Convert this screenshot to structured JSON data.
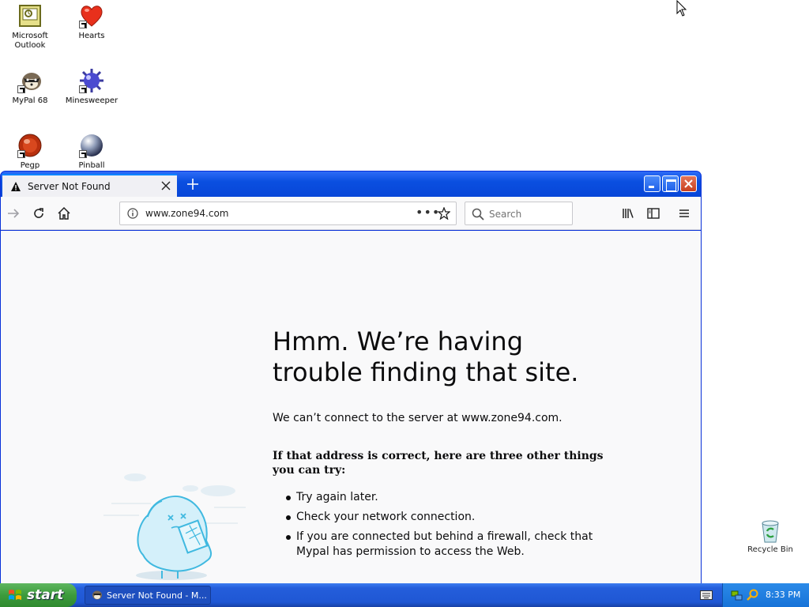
{
  "desktop": {
    "icons": [
      {
        "label": "Microsoft Outlook",
        "icon": "outlook-icon"
      },
      {
        "label": "Hearts",
        "icon": "hearts-icon"
      },
      {
        "label": "MyPal 68",
        "icon": "mypal-icon"
      },
      {
        "label": "Minesweeper",
        "icon": "minesweeper-icon"
      },
      {
        "label": "Pegp",
        "icon": "pegp-icon"
      },
      {
        "label": "Pinball",
        "icon": "pinball-icon"
      }
    ],
    "recycle_bin": {
      "label": "Recycle Bin",
      "icon": "recycle-bin-icon"
    }
  },
  "browser": {
    "tab": {
      "title": "Server Not Found",
      "icon": "warning-icon"
    },
    "new_tab_icon": "plus-icon",
    "url": "www.zone94.com",
    "search": {
      "placeholder": "Search"
    },
    "accent": "#0a84ff"
  },
  "error_page": {
    "title": "Hmm. We’re having trouble finding that site.",
    "description": "We can’t connect to the server at www.zone94.com.",
    "subtitle": "If that address is correct, here are three other things you can try:",
    "tips": [
      "Try again later.",
      "Check your network connection.",
      "If you are connected but behind a firewall, check that Mypal has permission to access the Web."
    ]
  },
  "taskbar": {
    "start_label": "start",
    "task_item": "Server Not Found - M...",
    "clock": "8:33 PM",
    "color": "#245edb"
  }
}
